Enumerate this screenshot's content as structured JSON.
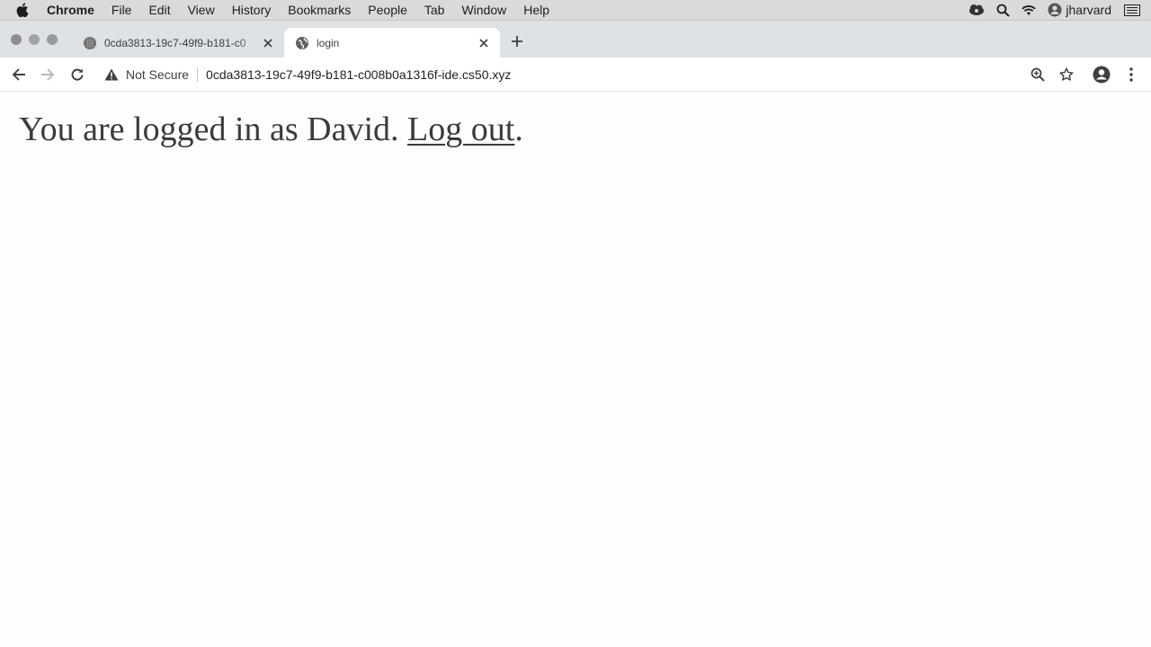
{
  "menubar": {
    "items": [
      "Chrome",
      "File",
      "Edit",
      "View",
      "History",
      "Bookmarks",
      "People",
      "Tab",
      "Window",
      "Help"
    ],
    "user": "jharvard"
  },
  "tabs": [
    {
      "title": "0cda3813-19c7-49f9-b181-c0",
      "icon": "ide-icon",
      "active": false
    },
    {
      "title": "login",
      "icon": "globe-icon",
      "active": true
    }
  ],
  "toolbar": {
    "security_label": "Not Secure",
    "url": "0cda3813-19c7-49f9-b181-c008b0a1316f-ide.cs50.xyz"
  },
  "page": {
    "message": "You are logged in as David.",
    "link_text": "Log out",
    "trailing": "."
  },
  "colors": {
    "text": "#3b3b3b",
    "tabstrip": "#dee1e6",
    "menubar": "#dadada"
  }
}
